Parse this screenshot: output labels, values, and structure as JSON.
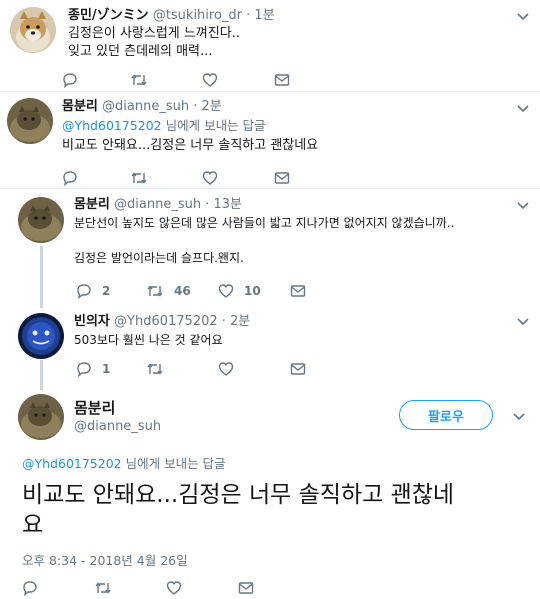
{
  "tweets": [
    {
      "name": "종민/ゾンミン",
      "handle": "@tsukihiro_dr",
      "time": "· 1분",
      "text_lines": [
        "김정은이 사랑스럽게 느껴진다..",
        "잊고 있던 츤데레의 매력..."
      ],
      "avatar": "dog-avatar"
    },
    {
      "name": "몸분리",
      "handle": "@dianne_suh",
      "time": "· 2분",
      "reply_mention": "@Yhd60175202",
      "reply_suffix": " 님에게 보내는 답글",
      "text": "비교도 안돼요...김정은 너무 솔직하고 괜찮네요",
      "avatar": "cat-avatar"
    },
    {
      "name": "몸분리",
      "handle": "@dianne_suh",
      "time": "· 13분",
      "text_line1": "분단선이 높지도 않은데 많은 사람들이 밟고 지나가면 없어지지 않겠습니까..",
      "text_line2": "김정은 발언이라는데 슬프다.왠지.",
      "replies": "2",
      "retweets": "46",
      "likes": "10",
      "avatar": "cat-avatar"
    },
    {
      "name": "빈의자",
      "handle": "@Yhd60175202",
      "time": "· 2분",
      "text": "503보다 훨씬 나은 것 같어요",
      "replies": "1",
      "avatar": "blue-face-avatar"
    }
  ],
  "main_tweet": {
    "name": "몸분리",
    "handle": "@dianne_suh",
    "follow_label": "팔로우",
    "reply_mention": "@Yhd60175202",
    "reply_suffix": " 님에게 보내는 답글",
    "text_line1": "비교도 안돼요...김정은 너무 솔직하고 괜찮네",
    "text_line2": "요",
    "datetime": "오후 8:34 - 2018년 4월 26일",
    "avatar": "cat-avatar"
  },
  "colors": {
    "accent": "#1da1f2",
    "muted": "#657786",
    "divider": "#e6ecf0",
    "thread": "#ccd6dd"
  }
}
